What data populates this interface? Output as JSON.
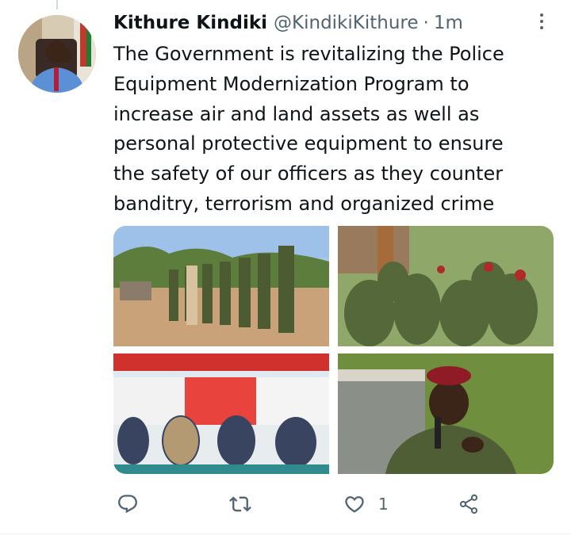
{
  "tweet": {
    "author_name": "Kithure Kindiki",
    "author_handle": "@KindikiKithure",
    "separator": "·",
    "time": "1m",
    "text": "The Government is revitalizing the Police\nEquipment Modernization Program to\nincrease air and land assets as well as\npersonal protective equipment to ensure\nthe safety of our officers as they counter\nbanditry, terrorism and organized crime"
  },
  "media": [
    {
      "subject": "officers in camouflage standing in a line outdoors"
    },
    {
      "subject": "group of officers in camouflage seated"
    },
    {
      "subject": "officials seated under a red tent at a meeting"
    },
    {
      "subject": "officer in red beret speaking into microphone"
    }
  ],
  "actions": {
    "reply_icon": "reply-icon",
    "retweet_icon": "retweet-icon",
    "like_icon": "heart-icon",
    "like_count": "1",
    "share_icon": "share-icon"
  },
  "colors": {
    "text_primary": "#0f1419",
    "text_secondary": "#536471",
    "divider": "#eff3f4"
  }
}
